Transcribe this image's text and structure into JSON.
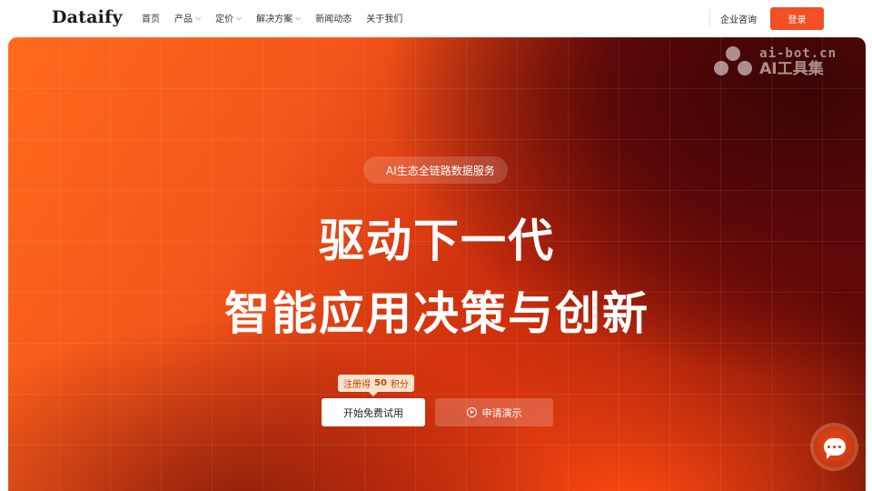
{
  "brand": {
    "logo": "Dataify"
  },
  "nav": {
    "items": [
      {
        "label": "首页",
        "has_menu": false
      },
      {
        "label": "产品",
        "has_menu": true
      },
      {
        "label": "定价",
        "has_menu": true
      },
      {
        "label": "解决方案",
        "has_menu": true
      },
      {
        "label": "新闻动态",
        "has_menu": false
      },
      {
        "label": "关于我们",
        "has_menu": false
      }
    ],
    "consult_label": "企业咨询",
    "login_label": "登录"
  },
  "watermark": {
    "line1": "ai-bot.cn",
    "line2": "AI工具集"
  },
  "hero": {
    "tagline": "AI生态全链路数据服务",
    "headline_1": "驱动下一代",
    "headline_2": "智能应用决策与创新",
    "badge_prefix": "注册得",
    "badge_value": "50",
    "badge_suffix": "积分",
    "primary_cta": "开始免费试用",
    "secondary_cta": "申请演示"
  },
  "colors": {
    "accent": "#f25022",
    "hero_dark": "#4a0505",
    "hero_bright": "#ff6a1c"
  },
  "icons": {
    "chevron": "chevron-down-icon",
    "play": "play-circle-icon",
    "chat": "chat-icon"
  }
}
